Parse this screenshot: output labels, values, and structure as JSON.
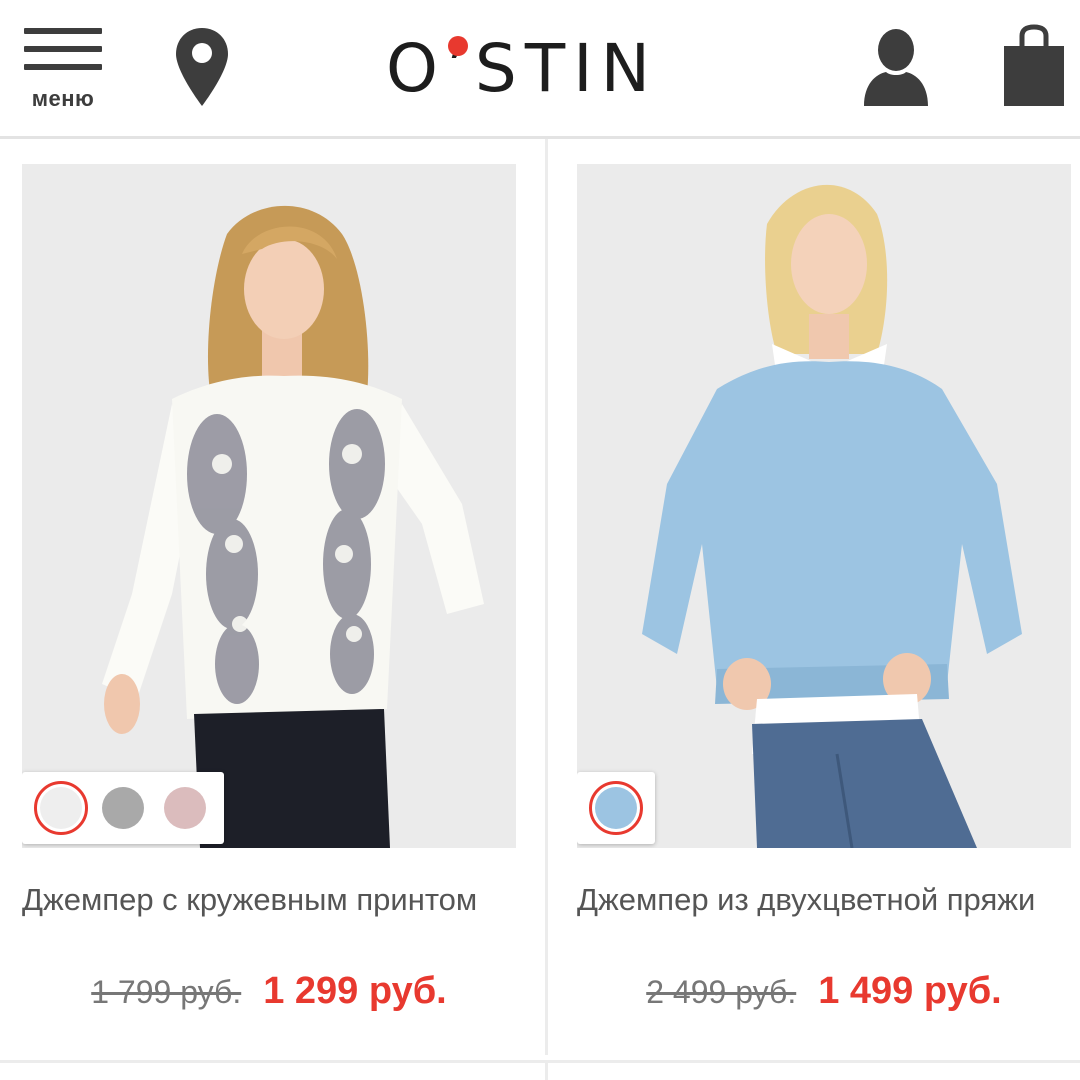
{
  "header": {
    "menu_label": "меню",
    "logo_text": "O’STIN",
    "icons": [
      "menu-icon",
      "location-pin-icon",
      "account-icon",
      "shopping-bag-icon"
    ]
  },
  "colors": {
    "accent": "#e8392f",
    "icon": "#3d3d3d",
    "background_photo": "#ebebeb"
  },
  "products": [
    {
      "title": "Джемпер с кружевным принтом",
      "old_price": "1 799 руб.",
      "new_price": "1 299 руб.",
      "swatches": [
        {
          "color": "#eeeeee",
          "selected": true
        },
        {
          "color": "#a9a9a9",
          "selected": false
        },
        {
          "color": "#dbbcbd",
          "selected": false
        }
      ]
    },
    {
      "title": "Джемпер из двухцветной пряжи",
      "old_price": "2 499 руб.",
      "new_price": "1 499 руб.",
      "swatches": [
        {
          "color": "#9cc4e2",
          "selected": true
        }
      ]
    }
  ]
}
